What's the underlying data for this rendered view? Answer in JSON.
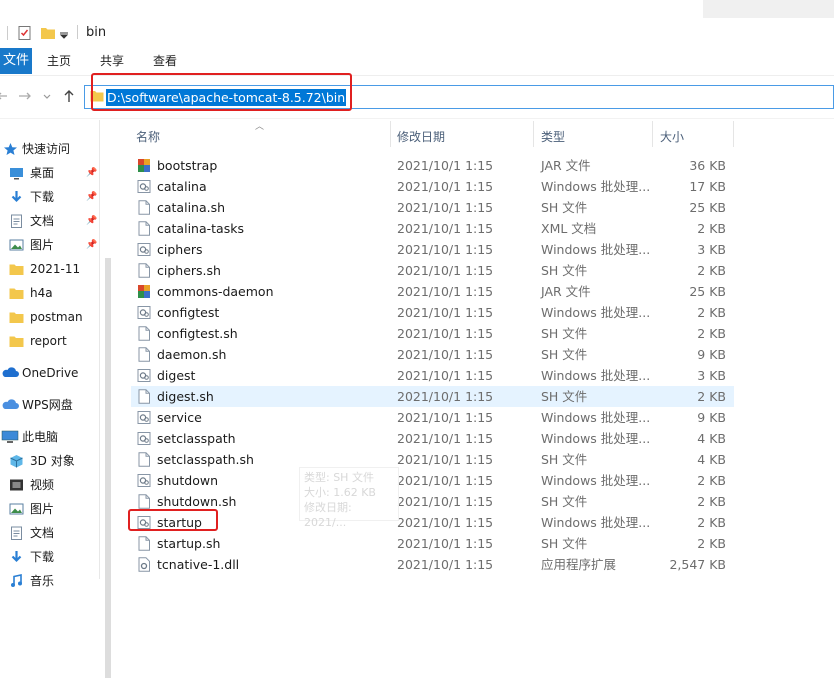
{
  "window": {
    "title": "bin"
  },
  "ribbon": {
    "file": "文件",
    "tabs": [
      "主页",
      "共享",
      "查看"
    ]
  },
  "address": {
    "path": "D:\\software\\apache-tomcat-8.5.72\\bin"
  },
  "nav": {
    "quick_access": "快速访问",
    "items": [
      {
        "label": "桌面",
        "icon": "desktop-icon",
        "pinned": true
      },
      {
        "label": "下载",
        "icon": "download-icon",
        "pinned": true
      },
      {
        "label": "文档",
        "icon": "document-icon",
        "pinned": true
      },
      {
        "label": "图片",
        "icon": "picture-icon",
        "pinned": true
      },
      {
        "label": "2021-11",
        "icon": "folder-icon",
        "pinned": false
      },
      {
        "label": "h4a",
        "icon": "folder-icon",
        "pinned": false
      },
      {
        "label": "postman",
        "icon": "folder-icon",
        "pinned": false
      },
      {
        "label": "report",
        "icon": "folder-icon",
        "pinned": false
      }
    ],
    "onedrive": "OneDrive",
    "wps": "WPS网盘",
    "this_pc": "此电脑",
    "pc_items": [
      {
        "label": "3D 对象",
        "icon": "3d-objects-icon"
      },
      {
        "label": "视频",
        "icon": "video-icon"
      },
      {
        "label": "图片",
        "icon": "picture-icon"
      },
      {
        "label": "文档",
        "icon": "document-icon"
      },
      {
        "label": "下载",
        "icon": "download-icon"
      },
      {
        "label": "音乐",
        "icon": "music-icon"
      }
    ]
  },
  "columns": {
    "name": "名称",
    "date": "修改日期",
    "type": "类型",
    "size": "大小"
  },
  "files": [
    {
      "name": "bootstrap",
      "date": "2021/10/1 1:15",
      "type": "JAR 文件",
      "size": "36 KB",
      "icon": "jar"
    },
    {
      "name": "catalina",
      "date": "2021/10/1 1:15",
      "type": "Windows 批处理...",
      "size": "17 KB",
      "icon": "bat"
    },
    {
      "name": "catalina.sh",
      "date": "2021/10/1 1:15",
      "type": "SH 文件",
      "size": "25 KB",
      "icon": "file"
    },
    {
      "name": "catalina-tasks",
      "date": "2021/10/1 1:15",
      "type": "XML 文档",
      "size": "2 KB",
      "icon": "file"
    },
    {
      "name": "ciphers",
      "date": "2021/10/1 1:15",
      "type": "Windows 批处理...",
      "size": "3 KB",
      "icon": "bat"
    },
    {
      "name": "ciphers.sh",
      "date": "2021/10/1 1:15",
      "type": "SH 文件",
      "size": "2 KB",
      "icon": "file"
    },
    {
      "name": "commons-daemon",
      "date": "2021/10/1 1:15",
      "type": "JAR 文件",
      "size": "25 KB",
      "icon": "jar"
    },
    {
      "name": "configtest",
      "date": "2021/10/1 1:15",
      "type": "Windows 批处理...",
      "size": "2 KB",
      "icon": "bat"
    },
    {
      "name": "configtest.sh",
      "date": "2021/10/1 1:15",
      "type": "SH 文件",
      "size": "2 KB",
      "icon": "file"
    },
    {
      "name": "daemon.sh",
      "date": "2021/10/1 1:15",
      "type": "SH 文件",
      "size": "9 KB",
      "icon": "file"
    },
    {
      "name": "digest",
      "date": "2021/10/1 1:15",
      "type": "Windows 批处理...",
      "size": "3 KB",
      "icon": "bat"
    },
    {
      "name": "digest.sh",
      "date": "2021/10/1 1:15",
      "type": "SH 文件",
      "size": "2 KB",
      "icon": "file",
      "hover": true
    },
    {
      "name": "service",
      "date": "2021/10/1 1:15",
      "type": "Windows 批处理...",
      "size": "9 KB",
      "icon": "bat"
    },
    {
      "name": "setclasspath",
      "date": "2021/10/1 1:15",
      "type": "Windows 批处理...",
      "size": "4 KB",
      "icon": "bat"
    },
    {
      "name": "setclasspath.sh",
      "date": "2021/10/1 1:15",
      "type": "SH 文件",
      "size": "4 KB",
      "icon": "file"
    },
    {
      "name": "shutdown",
      "date": "2021/10/1 1:15",
      "type": "Windows 批处理...",
      "size": "2 KB",
      "icon": "bat"
    },
    {
      "name": "shutdown.sh",
      "date": "2021/10/1 1:15",
      "type": "SH 文件",
      "size": "2 KB",
      "icon": "file"
    },
    {
      "name": "startup",
      "date": "2021/10/1 1:15",
      "type": "Windows 批处理...",
      "size": "2 KB",
      "icon": "bat"
    },
    {
      "name": "startup.sh",
      "date": "2021/10/1 1:15",
      "type": "SH 文件",
      "size": "2 KB",
      "icon": "file"
    },
    {
      "name": "tcnative-1.dll",
      "date": "2021/10/1 1:15",
      "type": "应用程序扩展",
      "size": "2,547 KB",
      "icon": "dll"
    }
  ],
  "tooltip": {
    "lines": [
      "类型: SH 文件",
      "大小: 1.62 KB",
      "修改日期: 2021/..."
    ]
  },
  "colors": {
    "accent": "#0078d7",
    "file_tab": "#1979ca",
    "highlight_box": "#e02020",
    "hover_row": "#e5f3ff"
  }
}
